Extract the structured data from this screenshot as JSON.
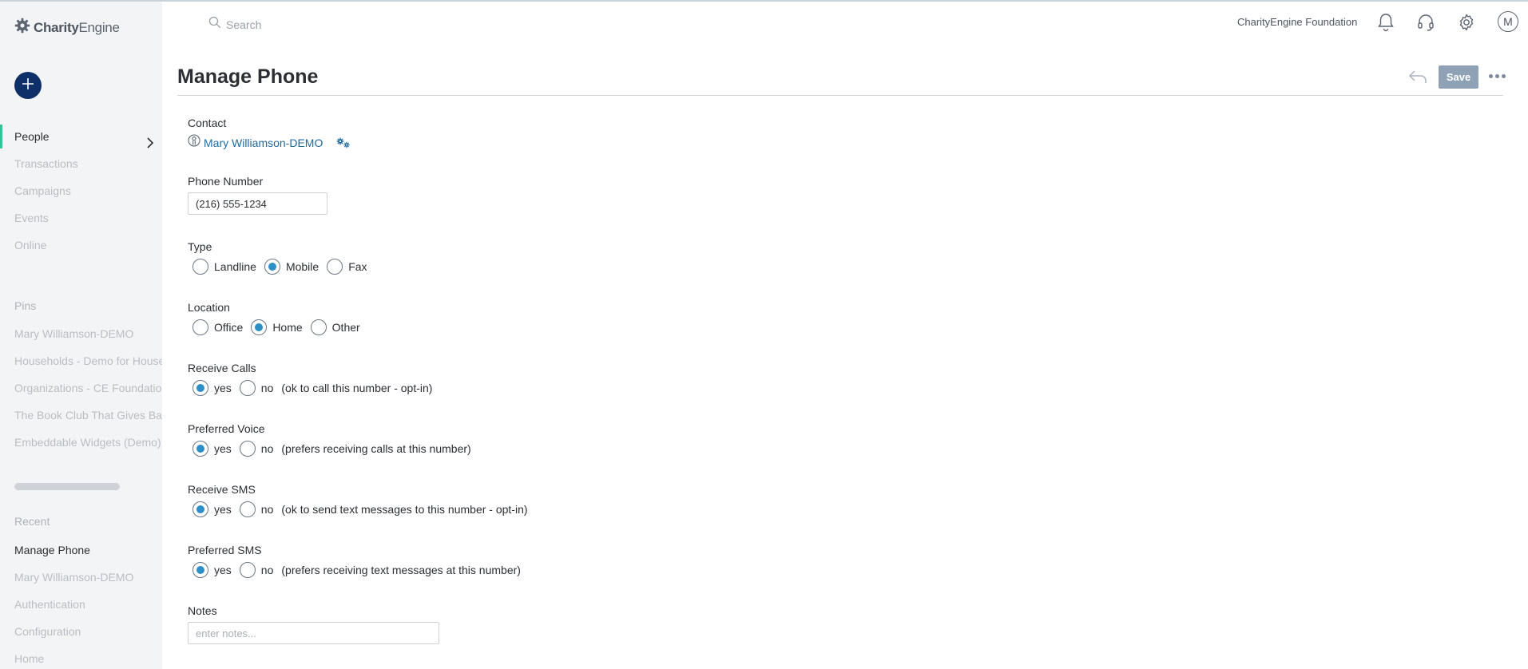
{
  "app": {
    "logo_strong": "Charity",
    "logo_light": "Engine"
  },
  "sidebar": {
    "nav": [
      {
        "label": "People",
        "active": true
      },
      {
        "label": "Transactions"
      },
      {
        "label": "Campaigns"
      },
      {
        "label": "Events"
      },
      {
        "label": "Online"
      }
    ],
    "pins_label": "Pins",
    "pins": [
      "Mary Williamson-DEMO",
      "Households - Demo for House",
      "Organizations - CE Foundation",
      "The Book Club That Gives Bac",
      "Embeddable Widgets (Demo)"
    ],
    "recent_label": "Recent",
    "recent": [
      "Manage Phone",
      "Mary Williamson-DEMO",
      "Authentication",
      "Configuration",
      "Home"
    ]
  },
  "topbar": {
    "search_placeholder": "Search",
    "org_name": "CharityEngine Foundation",
    "avatar_initial": "M"
  },
  "header": {
    "title": "Manage Phone",
    "save_label": "Save"
  },
  "form": {
    "contact": {
      "label": "Contact",
      "name": "Mary Williamson-DEMO"
    },
    "phone": {
      "label": "Phone Number",
      "value": "(216) 555-1234"
    },
    "type": {
      "label": "Type",
      "options": [
        "Landline",
        "Mobile",
        "Fax"
      ],
      "selected": "Mobile"
    },
    "location": {
      "label": "Location",
      "options": [
        "Office",
        "Home",
        "Other"
      ],
      "selected": "Home"
    },
    "receive_calls": {
      "label": "Receive Calls",
      "yes": "yes",
      "no": "no",
      "selected": "yes",
      "note": "(ok to call this number - opt-in)"
    },
    "preferred_voice": {
      "label": "Preferred Voice",
      "yes": "yes",
      "no": "no",
      "selected": "yes",
      "note": "(prefers receiving calls at this number)"
    },
    "receive_sms": {
      "label": "Receive SMS",
      "yes": "yes",
      "no": "no",
      "selected": "yes",
      "note": "(ok to send text messages to this number - opt-in)"
    },
    "preferred_sms": {
      "label": "Preferred SMS",
      "yes": "yes",
      "no": "no",
      "selected": "yes",
      "note": "(prefers receiving text messages at this number)"
    },
    "notes": {
      "label": "Notes",
      "placeholder": "enter notes...",
      "value": ""
    }
  },
  "colors": {
    "accent": "#2d8fc8",
    "brand_navy": "#0f2f68",
    "active_indicator": "#37c39a",
    "save_button": "#8fa1b4",
    "link": "#1f6aa0"
  },
  "icons": {
    "logo": "gear-logo-icon",
    "add": "plus-icon",
    "nav_chevron": "chevron-right-icon",
    "search": "search-icon",
    "notifications": "bell-icon",
    "support": "headset-icon",
    "settings": "gear-icon",
    "undo": "undo-arrow-icon",
    "more": "more-dots-icon",
    "contact": "person-icon",
    "contact_settings": "gears-icon"
  }
}
